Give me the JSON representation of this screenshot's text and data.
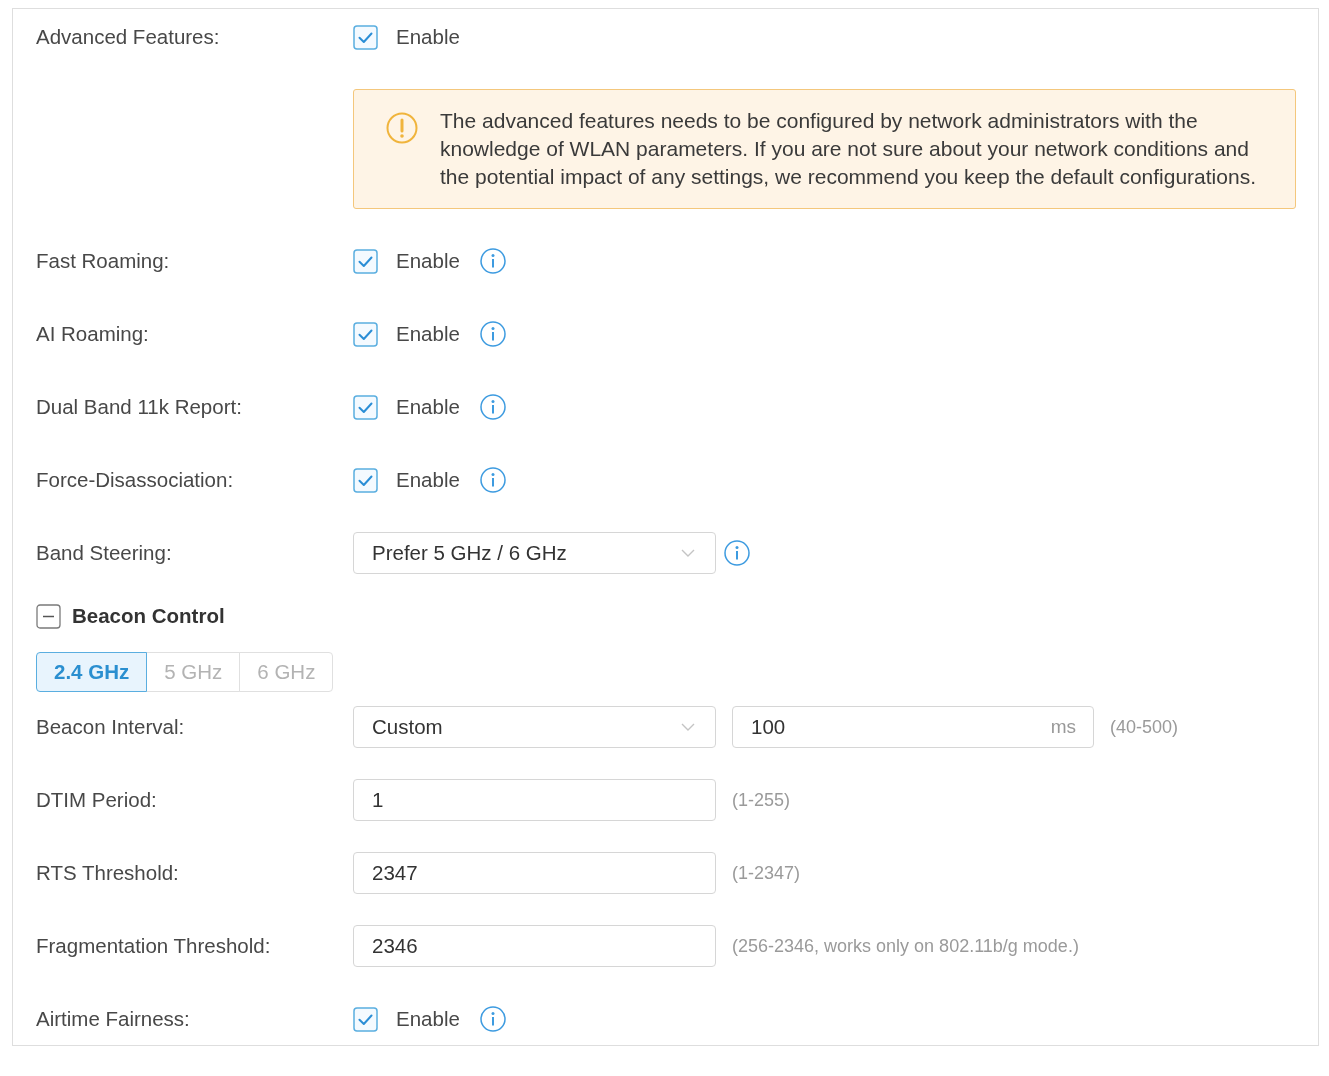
{
  "panel": {
    "rows": [
      {
        "kind": "checkbox",
        "label": "Advanced Features:",
        "option": "Enable",
        "checked": true,
        "info": false
      },
      {
        "kind": "notice",
        "text": "The advanced features needs to be configured by network administrators with the knowledge of WLAN parameters. If you are not sure about your network conditions and the potential impact of any settings, we recommend you keep the default configurations."
      },
      {
        "kind": "checkbox",
        "label": "Fast Roaming:",
        "option": "Enable",
        "checked": true,
        "info": true
      },
      {
        "kind": "checkbox",
        "label": "AI Roaming:",
        "option": "Enable",
        "checked": true,
        "info": true
      },
      {
        "kind": "checkbox",
        "label": "Dual Band 11k Report:",
        "option": "Enable",
        "checked": true,
        "info": true
      },
      {
        "kind": "checkbox",
        "label": "Force-Disassociation:",
        "option": "Enable",
        "checked": true,
        "info": true
      },
      {
        "kind": "select",
        "label": "Band Steering:",
        "value": "Prefer 5 GHz / 6 GHz",
        "info": true
      },
      {
        "kind": "section",
        "title": "Beacon Control",
        "expanded": true
      },
      {
        "kind": "tabs",
        "tabs": [
          {
            "label": "2.4 GHz",
            "selected": true
          },
          {
            "label": "5 GHz",
            "selected": false
          },
          {
            "label": "6 GHz",
            "selected": false
          }
        ]
      },
      {
        "kind": "select_input",
        "label": "Beacon Interval:",
        "value": "Custom",
        "input": "100",
        "unit": "ms",
        "hint": "(40-500)"
      },
      {
        "kind": "input",
        "label": "DTIM Period:",
        "value": "1",
        "hint": "(1-255)"
      },
      {
        "kind": "input",
        "label": "RTS Threshold:",
        "value": "2347",
        "hint": "(1-2347)"
      },
      {
        "kind": "input",
        "label": "Fragmentation Threshold:",
        "value": "2346",
        "hint": "(256-2346, works only on 802.11b/g mode.)"
      },
      {
        "kind": "checkbox",
        "label": "Airtime Fairness:",
        "option": "Enable",
        "checked": true,
        "info": true
      }
    ]
  }
}
